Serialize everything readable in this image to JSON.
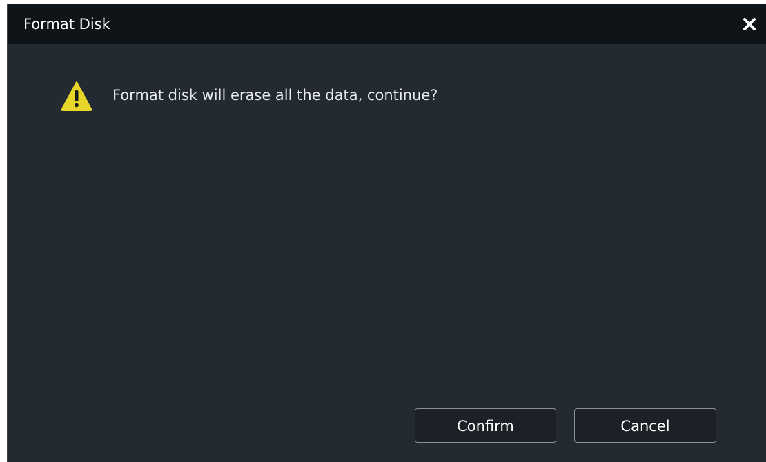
{
  "dialog": {
    "title": "Format Disk",
    "message": "Format disk will erase all the data, continue?",
    "icon": "warning-triangle",
    "close_icon": "close-x",
    "buttons": {
      "confirm_label": "Confirm",
      "cancel_label": "Cancel"
    }
  },
  "colors": {
    "titlebar_bg": "#0f1419",
    "body_bg": "#232a32",
    "warning_yellow": "#e8d52a",
    "button_border": "#8a9097"
  }
}
